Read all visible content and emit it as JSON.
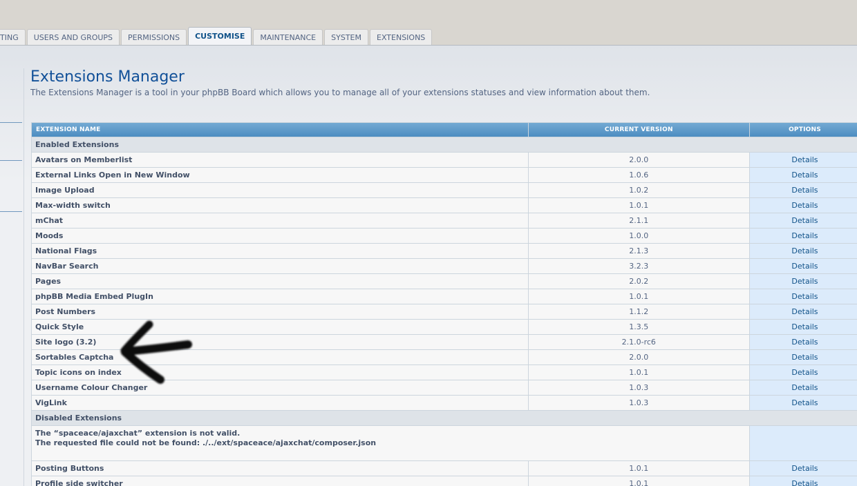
{
  "tabs": [
    {
      "label": "TING"
    },
    {
      "label": "USERS AND GROUPS"
    },
    {
      "label": "PERMISSIONS"
    },
    {
      "label": "CUSTOMISE"
    },
    {
      "label": "MAINTENANCE"
    },
    {
      "label": "SYSTEM"
    },
    {
      "label": "EXTENSIONS"
    }
  ],
  "page": {
    "title": "Extensions Manager",
    "description": "The Extensions Manager is a tool in your phpBB Board which allows you to manage all of your extensions statuses and view information about them."
  },
  "table": {
    "headers": {
      "name": "EXTENSION NAME",
      "version": "CURRENT VERSION",
      "options": "OPTIONS"
    },
    "enabled_label": "Enabled Extensions",
    "enabled": [
      {
        "name": "Avatars on Memberlist",
        "version": "2.0.0",
        "action": "Details"
      },
      {
        "name": "External Links Open in New Window",
        "version": "1.0.6",
        "action": "Details"
      },
      {
        "name": "Image Upload",
        "version": "1.0.2",
        "action": "Details"
      },
      {
        "name": "Max-width switch",
        "version": "1.0.1",
        "action": "Details"
      },
      {
        "name": "mChat",
        "version": "2.1.1",
        "action": "Details"
      },
      {
        "name": "Moods",
        "version": "1.0.0",
        "action": "Details"
      },
      {
        "name": "National Flags",
        "version": "2.1.3",
        "action": "Details"
      },
      {
        "name": "NavBar Search",
        "version": "3.2.3",
        "action": "Details"
      },
      {
        "name": "Pages",
        "version": "2.0.2",
        "action": "Details"
      },
      {
        "name": "phpBB Media Embed PlugIn",
        "version": "1.0.1",
        "action": "Details"
      },
      {
        "name": "Post Numbers",
        "version": "1.1.2",
        "action": "Details"
      },
      {
        "name": "Quick Style",
        "version": "1.3.5",
        "action": "Details"
      },
      {
        "name": "Site logo (3.2)",
        "version": "2.1.0-rc6",
        "action": "Details"
      },
      {
        "name": "Sortables Captcha",
        "version": "2.0.0",
        "action": "Details"
      },
      {
        "name": "Topic icons on index",
        "version": "1.0.1",
        "action": "Details"
      },
      {
        "name": "Username Colour Changer",
        "version": "1.0.3",
        "action": "Details"
      },
      {
        "name": "VigLink",
        "version": "1.0.3",
        "action": "Details"
      }
    ],
    "disabled_label": "Disabled Extensions",
    "error": {
      "line1": "The “spaceace/ajaxchat” extension is not valid.",
      "line2": "The requested file could not be found: ./../ext/spaceace/ajaxchat/composer.json"
    },
    "disabled": [
      {
        "name": "Posting Buttons",
        "version": "1.0.1",
        "action": "Details"
      },
      {
        "name": "Profile side switcher",
        "version": "1.0.1",
        "action": "Details"
      }
    ]
  }
}
